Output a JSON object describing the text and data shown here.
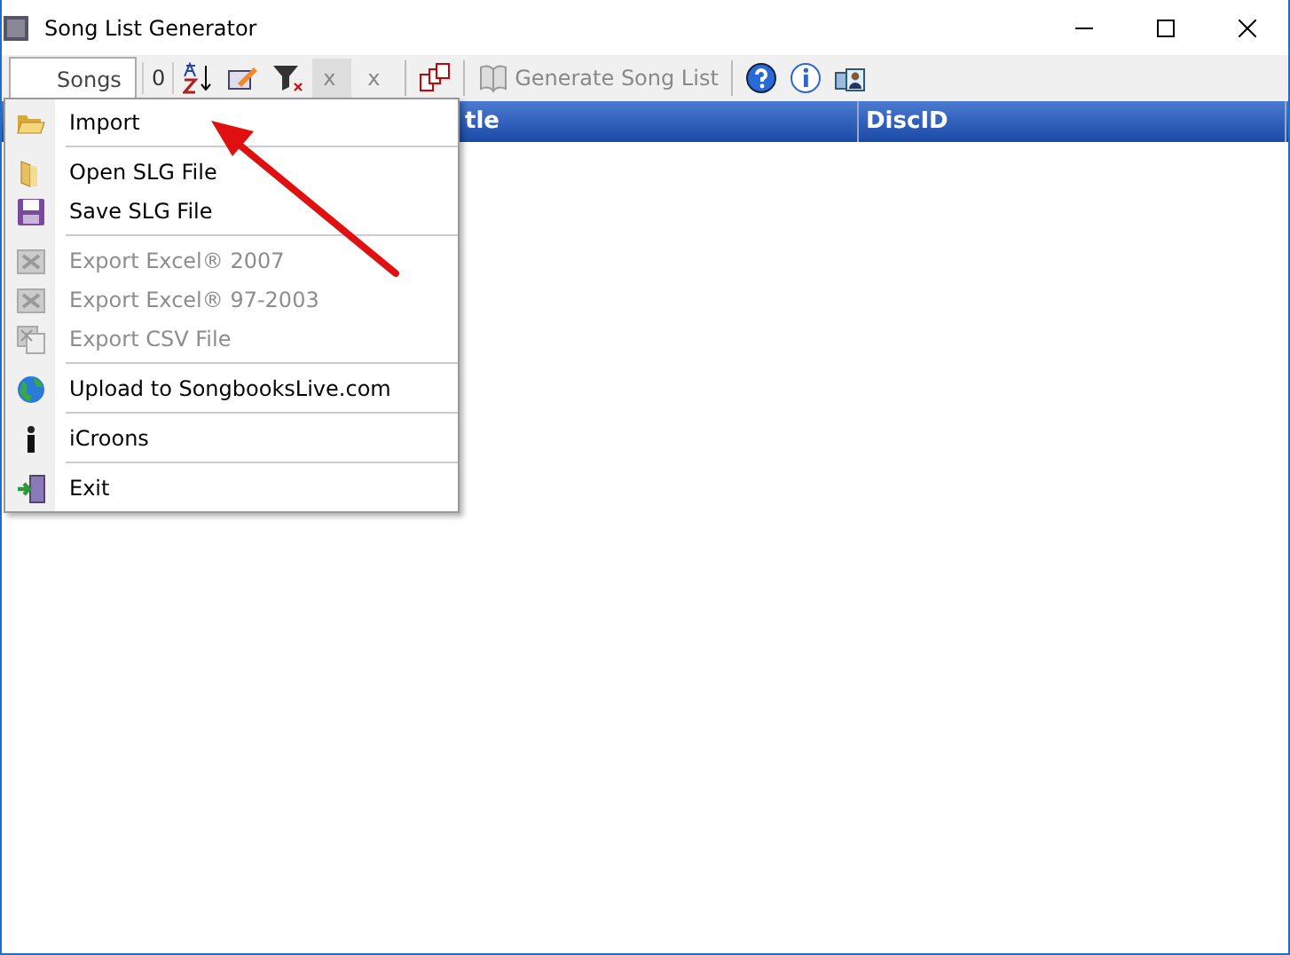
{
  "window": {
    "title": "Song List Generator"
  },
  "toolbar": {
    "tab": {
      "label": "Songs",
      "selected": true
    },
    "count": "0",
    "tools": [
      {
        "kind": "sort"
      },
      {
        "kind": "edit"
      },
      {
        "kind": "filter"
      },
      {
        "kind": "text",
        "label": "x",
        "disabled": true
      },
      {
        "kind": "text",
        "label": "x",
        "disabled": true
      },
      {
        "kind": "separator"
      },
      {
        "kind": "numbering"
      },
      {
        "kind": "separator"
      },
      {
        "kind": "book",
        "label": "Generate Song List",
        "disabled": true
      },
      {
        "kind": "separator"
      },
      {
        "kind": "help"
      },
      {
        "kind": "info"
      },
      {
        "kind": "user"
      }
    ]
  },
  "table": {
    "columns": [
      {
        "label": "tle"
      },
      {
        "label": "DiscID"
      }
    ]
  },
  "menu": {
    "items": [
      {
        "kind": "item",
        "label": "Import",
        "disabled": false
      },
      {
        "kind": "separator"
      },
      {
        "kind": "item",
        "label": "Open SLG File",
        "disabled": false
      },
      {
        "kind": "item",
        "label": "Save SLG File",
        "disabled": false
      },
      {
        "kind": "separator"
      },
      {
        "kind": "item",
        "label": "Export Excel® 2007",
        "disabled": true
      },
      {
        "kind": "item",
        "label": "Export Excel® 97-2003",
        "disabled": true
      },
      {
        "kind": "item",
        "label": "Export CSV File",
        "disabled": true
      },
      {
        "kind": "separator"
      },
      {
        "kind": "item",
        "label": "Upload to SongbooksLive.com",
        "disabled": false
      },
      {
        "kind": "separator"
      },
      {
        "kind": "item",
        "label": "iCroons",
        "disabled": false
      },
      {
        "kind": "separator"
      },
      {
        "kind": "item",
        "label": "Exit",
        "disabled": false
      }
    ]
  },
  "annotation": {
    "kind": "arrow"
  }
}
